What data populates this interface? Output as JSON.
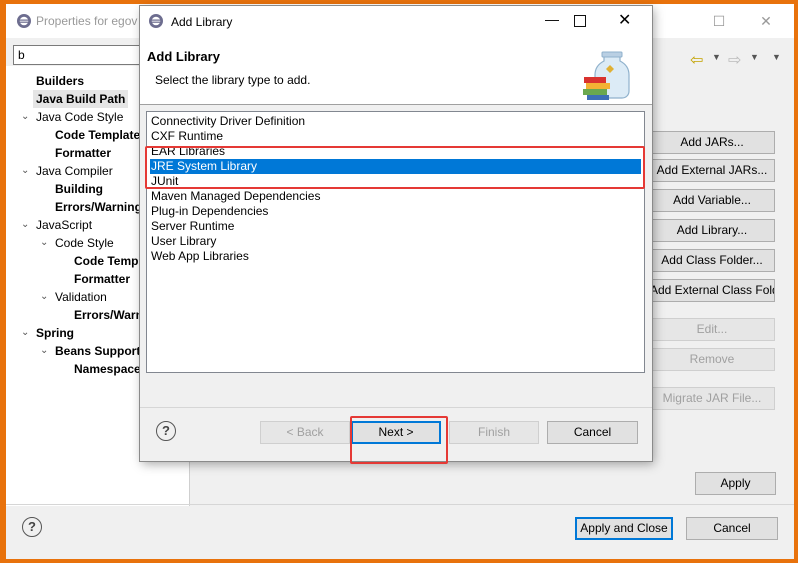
{
  "background_window": {
    "title": "Properties for egov",
    "filter_value": "b",
    "tree": [
      {
        "label": "Builders",
        "bold": true,
        "indent": 0,
        "twisty": ""
      },
      {
        "label": "Java Build Path",
        "bold": true,
        "indent": 0,
        "twisty": "",
        "selected": true
      },
      {
        "label": "Java Code Style",
        "bold": false,
        "indent": 0,
        "twisty": "v"
      },
      {
        "label": "Code Templates",
        "bold": true,
        "indent": 1,
        "twisty": ""
      },
      {
        "label": "Formatter",
        "bold": true,
        "indent": 1,
        "twisty": ""
      },
      {
        "label": "Java Compiler",
        "bold": false,
        "indent": 0,
        "twisty": "v"
      },
      {
        "label": "Building",
        "bold": true,
        "indent": 1,
        "twisty": ""
      },
      {
        "label": "Errors/Warnings",
        "bold": true,
        "indent": 1,
        "twisty": ""
      },
      {
        "label": "JavaScript",
        "bold": false,
        "indent": 0,
        "twisty": "v"
      },
      {
        "label": "Code Style",
        "bold": false,
        "indent": 1,
        "twisty": "v"
      },
      {
        "label": "Code Templates",
        "bold": true,
        "indent": 2,
        "twisty": ""
      },
      {
        "label": "Formatter",
        "bold": true,
        "indent": 2,
        "twisty": ""
      },
      {
        "label": "Validation",
        "bold": false,
        "indent": 1,
        "twisty": "v"
      },
      {
        "label": "Errors/Warnings",
        "bold": true,
        "indent": 2,
        "twisty": ""
      },
      {
        "label": "Spring",
        "bold": true,
        "indent": 0,
        "twisty": "v"
      },
      {
        "label": "Beans Support",
        "bold": true,
        "indent": 1,
        "twisty": "v"
      },
      {
        "label": "Namespaces",
        "bold": true,
        "indent": 2,
        "twisty": ""
      }
    ],
    "side_buttons": [
      {
        "label": "Add JARs...",
        "enabled": true
      },
      {
        "label": "Add External JARs...",
        "enabled": true
      },
      {
        "label": "Add Variable...",
        "enabled": true
      },
      {
        "label": "Add Library...",
        "enabled": true
      },
      {
        "label": "Add Class Folder...",
        "enabled": true
      },
      {
        "label": "Add External Class Folder...",
        "enabled": true
      },
      {
        "label": "Edit...",
        "enabled": false
      },
      {
        "label": "Remove",
        "enabled": false
      },
      {
        "label": "Migrate JAR File...",
        "enabled": false
      }
    ],
    "apply_label": "Apply",
    "apply_close_label": "Apply and Close",
    "cancel_label": "Cancel",
    "help_symbol": "?"
  },
  "dialog": {
    "title": "Add Library",
    "heading": "Add Library",
    "description": "Select the library type to add.",
    "libraries": [
      {
        "label": "Connectivity Driver Definition",
        "selected": false
      },
      {
        "label": "CXF Runtime",
        "selected": false
      },
      {
        "label": "EAR Libraries",
        "selected": false
      },
      {
        "label": "JRE System Library",
        "selected": true
      },
      {
        "label": "JUnit",
        "selected": false
      },
      {
        "label": "Maven Managed Dependencies",
        "selected": false
      },
      {
        "label": "Plug-in Dependencies",
        "selected": false
      },
      {
        "label": "Server Runtime",
        "selected": false
      },
      {
        "label": "User Library",
        "selected": false
      },
      {
        "label": "Web App Libraries",
        "selected": false
      }
    ],
    "back_label": "< Back",
    "next_label": "Next >",
    "finish_label": "Finish",
    "cancel_label": "Cancel",
    "help_symbol": "?",
    "close_symbol": "✕",
    "minimize_symbol": "—",
    "selection_color": "#0078d7",
    "annotation_color": "#e53935"
  },
  "colors": {
    "desktop": "#e8720c",
    "accent": "#0078d7"
  }
}
